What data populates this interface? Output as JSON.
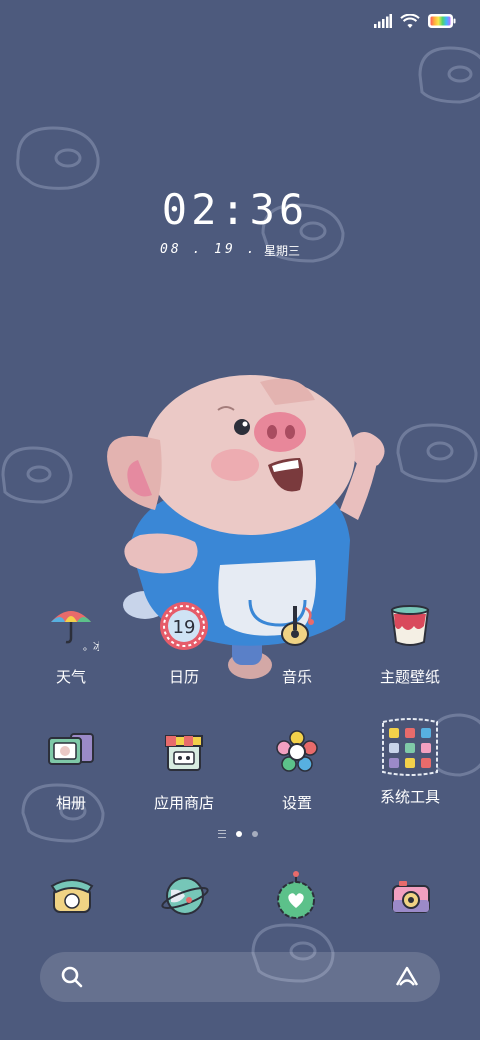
{
  "status_bar": {
    "signal_icon": "signal-icon",
    "wifi_icon": "wifi-icon",
    "battery_icon": "battery-icon"
  },
  "lock": {
    "time": "02:36",
    "date": "08 . 19 .",
    "weekday": "星期三"
  },
  "apps_row1": [
    {
      "label": "天气",
      "icon": "weather-umbrella-icon",
      "sub": "。冰"
    },
    {
      "label": "日历",
      "icon": "calendar-icon",
      "day": "19"
    },
    {
      "label": "音乐",
      "icon": "music-icon"
    },
    {
      "label": "主题壁纸",
      "icon": "theme-paint-icon"
    }
  ],
  "apps_row2": [
    {
      "label": "相册",
      "icon": "gallery-icon"
    },
    {
      "label": "应用商店",
      "icon": "app-store-icon"
    },
    {
      "label": "设置",
      "icon": "settings-flower-icon"
    },
    {
      "label": "系统工具",
      "icon": "system-tools-folder-icon"
    }
  ],
  "dock": [
    {
      "icon": "phone-icon"
    },
    {
      "icon": "browser-globe-icon"
    },
    {
      "icon": "messages-heart-icon"
    },
    {
      "icon": "camera-icon"
    }
  ],
  "pager": {
    "pages": 2,
    "current": 1
  },
  "search_bar": {
    "search_icon": "search-icon",
    "assistant_icon": "assistant-a-icon"
  },
  "colors": {
    "background": "#4d5a7d",
    "text": "#ffffff"
  }
}
